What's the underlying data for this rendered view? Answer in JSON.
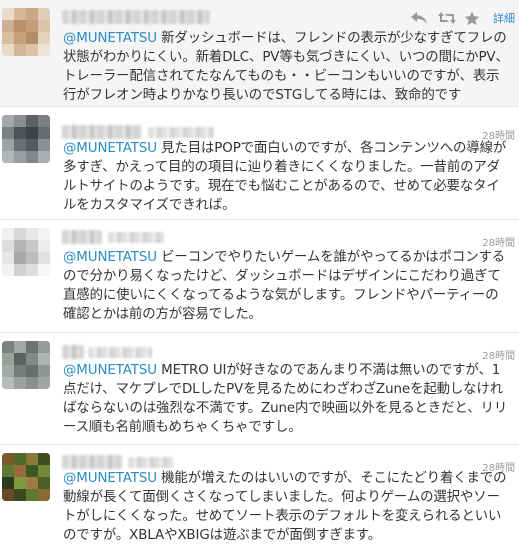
{
  "actions": {
    "expand_label": "詳細"
  },
  "tweets": [
    {
      "mention": "@MUNETATSU",
      "body": " 新ダッシュボードは、フレンドの表示が少なすぎてフレの状態がわかりにくい。新着DLC、PV等も気づきにくい、いつの間にかPV、トレーラー配信されてたなんてものも・・ビーコンもいいのですが、表示行がフレオン時よりかなり長いのでSTGしてる時には、致命的です",
      "timestamp": ""
    },
    {
      "mention": "@MUNETATSU",
      "body": " 見た目はPOPで面白いのですが、各コンテンツへの導線が多すぎ、かえって目的の項目に辿り着きにくくなりました。一昔前のアダルトサイトのようです。現在でも悩むことがあるので、せめて必要なタイルをカスタマイズできれば。",
      "timestamp": "28時間"
    },
    {
      "mention": "@MUNETATSU",
      "body": " ビーコンでやりたいゲームを誰がやってるかはポコンするので分かり易くなったけど、ダッシュボードはデザインにこだわり過ぎて直感的に使いにくくなってるような気がします。フレンドやパーティーの確認とかは前の方が容易でした。",
      "timestamp": "28時間"
    },
    {
      "mention": "@MUNETATSU",
      "body": " METRO UIが好きなのであんまり不満は無いのですが、1点だけ、マケプレでDLしたPVを見るためにわざわざZuneを起動しなければならないのは強烈な不満です。Zune内で映画以外を見るときだと、リリース順も名前順もめちゃくちゃですし。",
      "timestamp": "28時間"
    },
    {
      "mention": "@MUNETATSU",
      "body": " 機能が増えたのはいいのですが、そこにたどり着くまでの動線が長くて面倒くさくなってしまいました。何よりゲームの選択やソートがしにくくなった。せめてソート表示のデフォルトを変えられるといいのですが。XBLAやXBIGは遊ぶまでが面倒すぎます。",
      "timestamp": "28時間"
    }
  ]
}
